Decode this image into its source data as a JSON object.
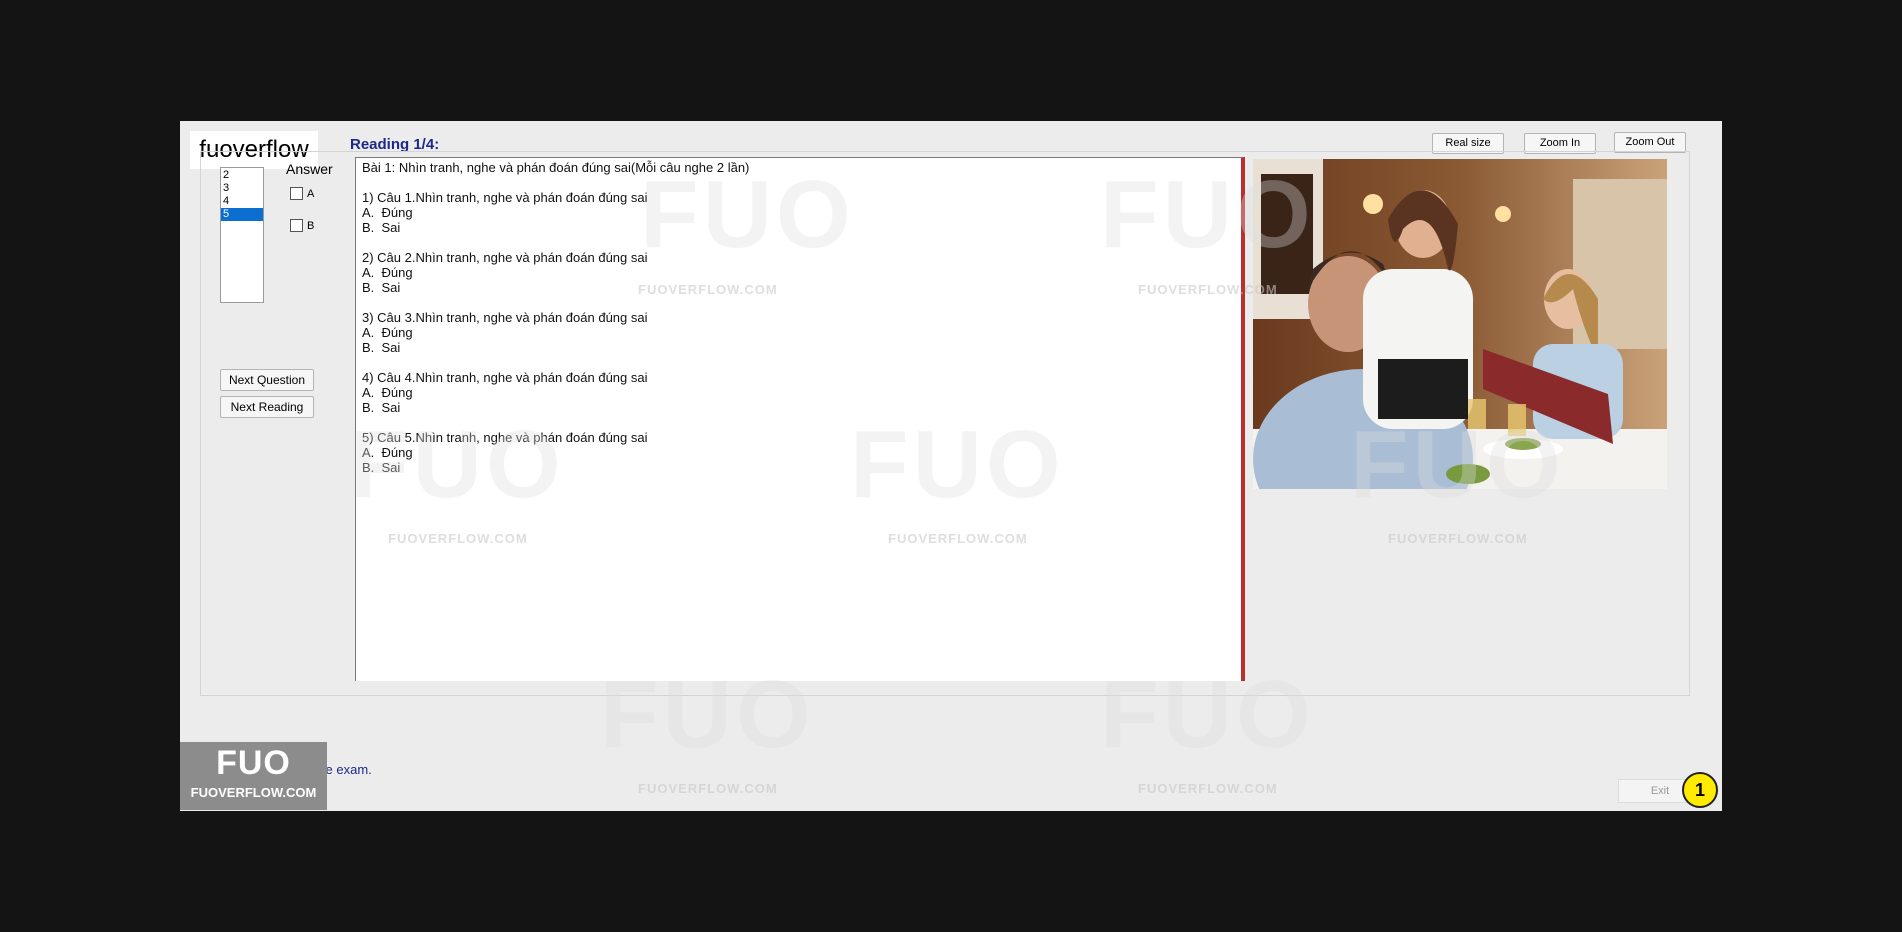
{
  "brand": "fuoverflow",
  "question_list": [
    "2",
    "3",
    "4",
    "5"
  ],
  "selected_question": "5",
  "answer": {
    "label": "Answer",
    "options": [
      "A",
      "B"
    ]
  },
  "buttons": {
    "next_question": "Next Question",
    "next_reading": "Next Reading",
    "real_size": "Real size",
    "zoom_in": "Zoom In",
    "zoom_out": "Zoom Out",
    "exit": "Exit"
  },
  "reading_title": "Reading 1/4:",
  "reading_text": [
    "Bài 1: Nhìn tranh, nghe và phán đoán đúng sai(Mỗi câu nghe 2 lần)",
    "",
    "1) Câu 1.Nhìn tranh, nghe và phán đoán đúng sai",
    "A.  Đúng",
    "B.  Sai",
    "",
    "2) Câu 2.Nhìn tranh, nghe và phán đoán đúng sai",
    "A.  Đúng",
    "B.  Sai",
    "",
    "3) Câu 3.Nhìn tranh, nghe và phán đoán đúng sai",
    "A.  Đúng",
    "B.  Sai",
    "",
    "4) Câu 4.Nhìn tranh, nghe và phán đoán đúng sai",
    "A.  Đúng",
    "B.  Sai",
    "",
    "5) Câu 5.Nhìn tranh, nghe và phán đoán đúng sai",
    "A.  Đúng",
    "B.  Sai"
  ],
  "finish_text": "I want to finish the exam.",
  "watermark": {
    "logo": "FUO",
    "site": "FUOVERFLOW.COM"
  },
  "badge": {
    "logo": "FUO",
    "site": "FUOVERFLOW.COM"
  },
  "step_number": "1",
  "colors": {
    "selection": "#0a6fd0",
    "title": "#1c2a86",
    "divider": "#b9312f",
    "step_badge": "#ffeb00"
  }
}
